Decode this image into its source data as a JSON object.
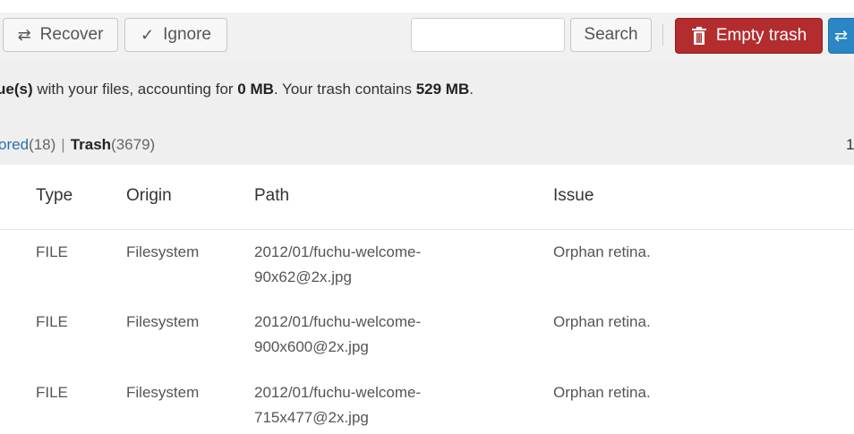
{
  "toolbar": {
    "recover_label": "Recover",
    "ignore_label": "Ignore",
    "search_placeholder": "",
    "search_label": "Search",
    "empty_trash_label": "Empty trash"
  },
  "summary": {
    "prefix": "ue(s)",
    "middle": " with your files, accounting for ",
    "mb_value": "0 MB",
    "trash_text": ". Your trash contains ",
    "trash_value": "529 MB",
    "suffix": "."
  },
  "filters": {
    "ignored_label": "ored",
    "ignored_count": "(18)",
    "separator": "|",
    "trash_label": "Trash",
    "trash_count": "(3679)"
  },
  "pager": {
    "text": "1"
  },
  "table": {
    "headers": [
      "Type",
      "Origin",
      "Path",
      "Issue"
    ],
    "rows": [
      {
        "type": "FILE",
        "origin": "Filesystem",
        "path_line1": "2012/01/fuchu-welcome-",
        "path_line2": "90x62@2x.jpg",
        "issue": "Orphan retina."
      },
      {
        "type": "FILE",
        "origin": "Filesystem",
        "path_line1": "2012/01/fuchu-welcome-",
        "path_line2": "900x600@2x.jpg",
        "issue": "Orphan retina."
      },
      {
        "type": "FILE",
        "origin": "Filesystem",
        "path_line1": "2012/01/fuchu-welcome-",
        "path_line2": "715x477@2x.jpg",
        "issue": "Orphan retina."
      }
    ]
  },
  "colors": {
    "danger": "#b32d2e",
    "primary": "#2a86c4",
    "link": "#2771b1"
  },
  "icons": {
    "recover": "recover-icon",
    "ignore": "checkmark-icon",
    "trash": "trash-icon",
    "blue_button": "recover-icon"
  }
}
